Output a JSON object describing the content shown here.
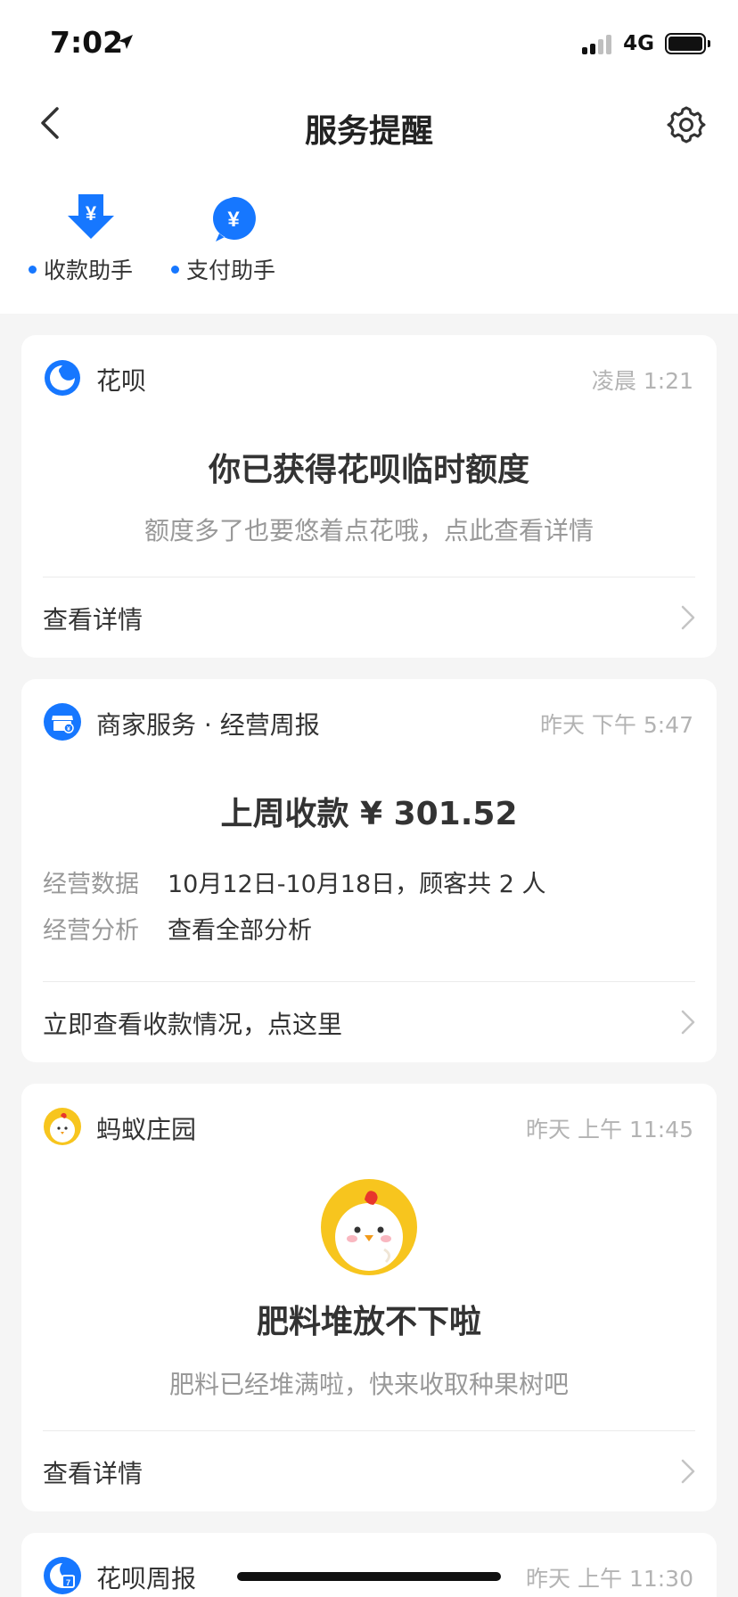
{
  "status_bar": {
    "time": "7:02",
    "network": "4G"
  },
  "nav": {
    "title": "服务提醒"
  },
  "assistants": [
    {
      "label": "收款助手"
    },
    {
      "label": "支付助手"
    }
  ],
  "cards": [
    {
      "source": "花呗",
      "time": "凌晨 1:21",
      "title": "你已获得花呗临时额度",
      "subtitle": "额度多了也要悠着点花哦，点此查看详情",
      "footer": "查看详情"
    },
    {
      "source": "商家服务 · 经营周报",
      "time": "昨天 下午 5:47",
      "title": "上周收款 ¥ 301.52",
      "rows": [
        {
          "key": "经营数据",
          "value": "10月12日-10月18日，顾客共 2 人"
        },
        {
          "key": "经营分析",
          "value": "查看全部分析"
        }
      ],
      "footer": "立即查看收款情况，点这里"
    },
    {
      "source": "蚂蚁庄园",
      "time": "昨天 上午 11:45",
      "title": "肥料堆放不下啦",
      "subtitle": "肥料已经堆满啦，快来收取种果树吧",
      "footer": "查看详情"
    },
    {
      "source": "花呗周报",
      "time": "昨天 上午 11:30"
    }
  ],
  "colors": {
    "accent": "#1677ff",
    "background": "#f5f5f5",
    "card": "#ffffff",
    "chick_yellow": "#f7c51e"
  },
  "icons": {
    "back": "chevron-left-icon",
    "settings": "gear-icon",
    "receive": "download-yuan-icon",
    "pay": "yuan-chat-bubble-icon",
    "huabei": "huabei-logo-icon",
    "merchant": "store-icon",
    "farm": "chick-icon",
    "weekly": "calendar-icon"
  }
}
